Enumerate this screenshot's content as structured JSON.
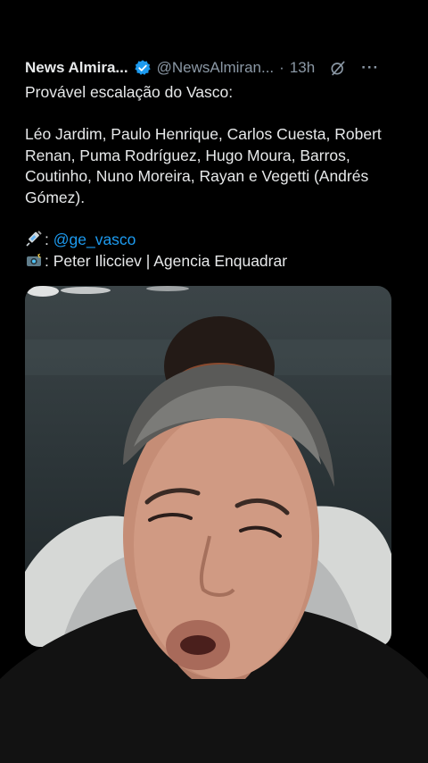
{
  "tweet": {
    "author_name": "News Almira...",
    "handle": "@NewsAlmiran...",
    "separator": "·",
    "time": "13h",
    "more": "···",
    "body": "Provável escalação do Vasco:\n\nLéo Jardim, Paulo Henrique, Carlos Cuesta, Robert Renan, Puma Rodríguez, Hugo Moura, Barros, Coutinho, Nuno Moreira, Rayan e Vegetti (Andrés Gómez).",
    "source_prefix": ": ",
    "source_link": "@ge_vasco",
    "photo_credit": ": Peter Ilicciev | Agencia Enquadrar"
  },
  "icons": {
    "verified": "verified-badge-icon",
    "grok": "grok-icon",
    "more": "more-options-icon",
    "syringe": "syringe-emoji-icon",
    "camera": "camera-flash-emoji-icon"
  },
  "colors": {
    "background": "#000000",
    "text": "#e7e9ea",
    "muted": "#8b98a5",
    "link": "#1d9bf0",
    "verified": "#1d9bf0"
  }
}
